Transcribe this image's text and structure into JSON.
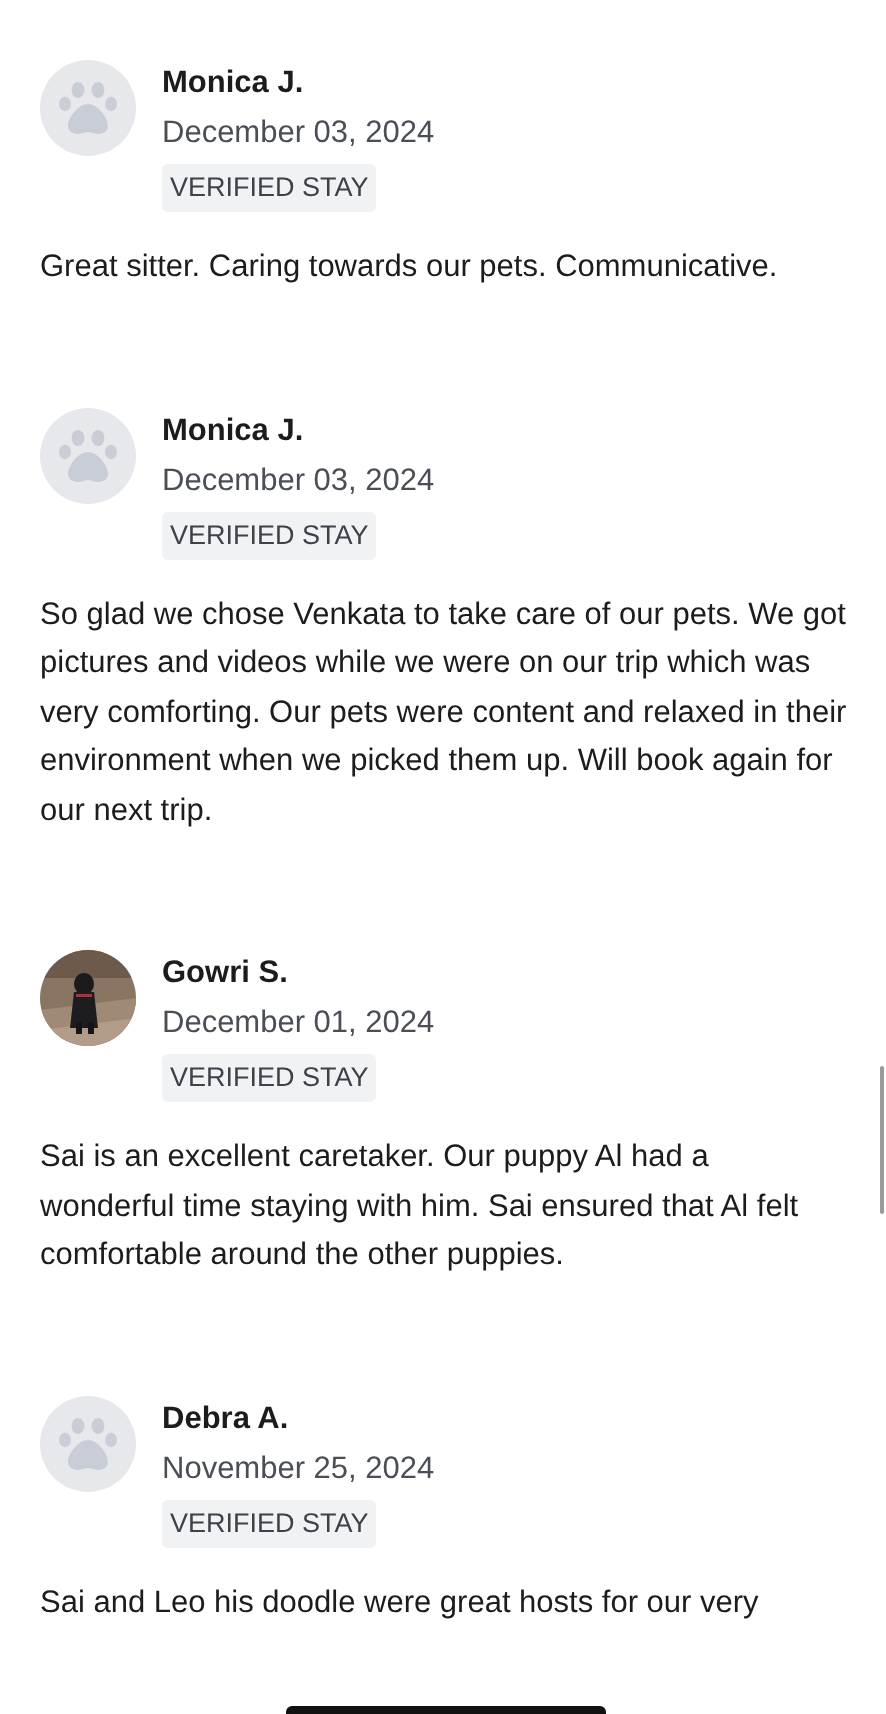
{
  "reviews": [
    {
      "name": "Monica J.",
      "date": "December 03, 2024",
      "badge": "VERIFIED STAY",
      "avatar": {
        "kind": "paw"
      },
      "text": "Great sitter. Caring towards our pets. Communicative."
    },
    {
      "name": "Monica J.",
      "date": "December 03, 2024",
      "badge": "VERIFIED STAY",
      "avatar": {
        "kind": "paw"
      },
      "text": "So glad we chose Venkata to take care of our pets. We got pictures and videos while we were on our trip which was very comforting. Our pets were content and relaxed in their environment when we picked them up. Will book again for our next trip."
    },
    {
      "name": "Gowri S.",
      "date": "December 01, 2024",
      "badge": "VERIFIED STAY",
      "text": "Sai is an excellent caretaker. Our puppy Al had a wonderful time staying with him. Sai ensured that Al felt comfortable around the other puppies."
    },
    {
      "name": "Debra A.",
      "date": "November 25, 2024",
      "badge": "VERIFIED STAY",
      "avatar": {
        "kind": "paw"
      },
      "text": "Sai and Leo his doodle were great hosts for our very"
    }
  ]
}
